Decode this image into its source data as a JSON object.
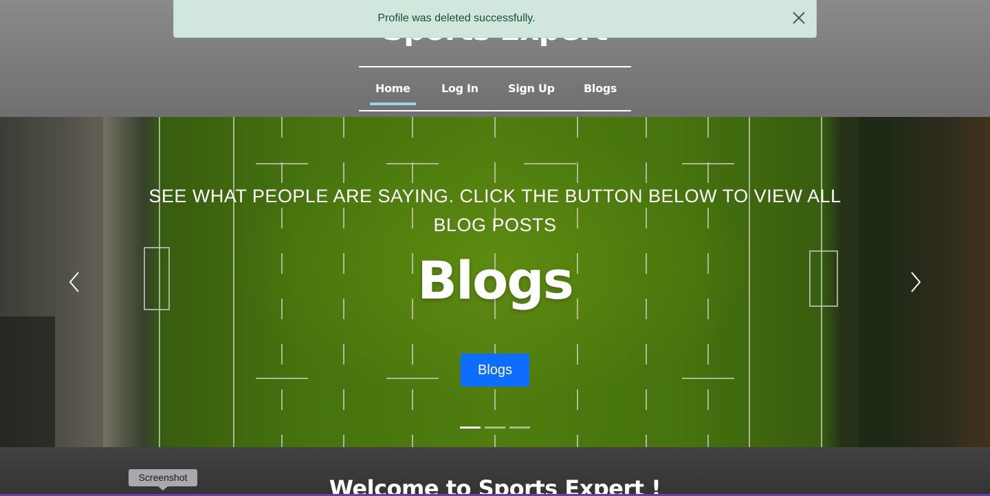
{
  "header": {
    "site_title": "Sports Expert",
    "nav": [
      {
        "label": "Home",
        "active": true
      },
      {
        "label": "Log In",
        "active": false
      },
      {
        "label": "Sign Up",
        "active": false
      },
      {
        "label": "Blogs",
        "active": false
      }
    ]
  },
  "toast": {
    "message": "Profile was deleted successfully.",
    "close_icon": "close-icon",
    "color_bg": "#d1e7dd",
    "color_text": "#0f5132"
  },
  "hero": {
    "caption": "SEE WHAT PEOPLE ARE SAYING. CLICK THE BUTTON BELOW TO VIEW ALL BLOG POSTS",
    "heading": "Blogs",
    "button_label": "Blogs",
    "button_color": "#0d6efd",
    "prev_icon": "chevron-left-icon",
    "next_icon": "chevron-right-icon",
    "slide_count": 3,
    "active_slide": 1
  },
  "welcome": {
    "title": "Welcome to Sports Expert !"
  },
  "tooltip": {
    "text": "Screenshot"
  }
}
